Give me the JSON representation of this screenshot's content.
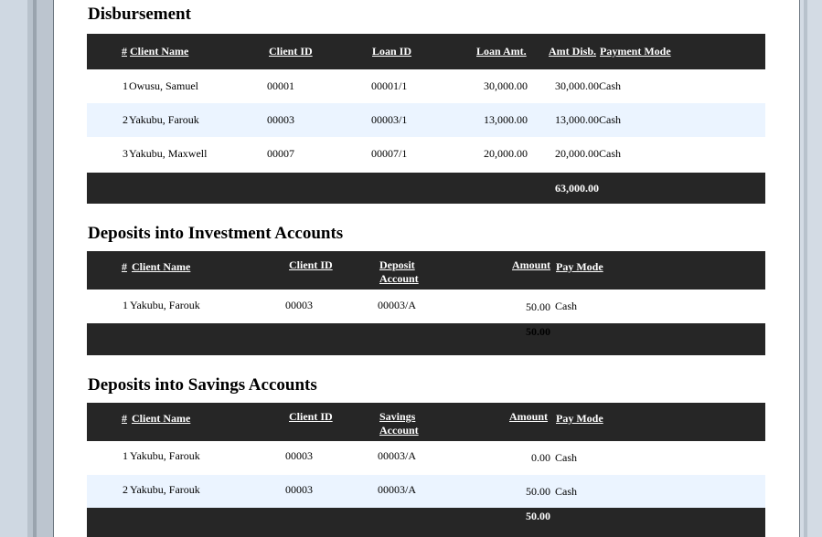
{
  "disbursement": {
    "title": "Disbursement",
    "headers": {
      "num": "#",
      "client_name": "Client Name",
      "client_id": "Client ID",
      "loan_id": "Loan ID",
      "loan_amt": "Loan Amt.",
      "amt_disb": "Amt Disb.",
      "payment_mode": "Payment Mode"
    },
    "rows": [
      {
        "num": "1",
        "client_name": "Owusu, Samuel",
        "client_id": "00001",
        "loan_id": "00001/1",
        "loan_amt": "30,000.00",
        "amt_disb": "30,000.00",
        "payment_mode": "Cash"
      },
      {
        "num": "2",
        "client_name": "Yakubu, Farouk",
        "client_id": "00003",
        "loan_id": "00003/1",
        "loan_amt": "13,000.00",
        "amt_disb": "13,000.00",
        "payment_mode": "Cash"
      },
      {
        "num": "3",
        "client_name": "Yakubu, Maxwell",
        "client_id": "00007",
        "loan_id": "00007/1",
        "loan_amt": "20,000.00",
        "amt_disb": "20,000.00",
        "payment_mode": "Cash"
      }
    ],
    "total": "63,000.00"
  },
  "investment_deposits": {
    "title": "Deposits into Investment Accounts",
    "headers": {
      "num": "#",
      "client_name": "Client Name",
      "client_id": "Client ID",
      "account_line1": "Deposit",
      "account_line2": "Account",
      "amount": "Amount",
      "pay_mode": "Pay Mode"
    },
    "rows": [
      {
        "num": "1",
        "client_name": "Yakubu, Farouk",
        "client_id": "00003",
        "account": "00003/A",
        "amount": "50.00",
        "pay_mode": "Cash"
      }
    ],
    "total": "50.00"
  },
  "savings_deposits": {
    "title": "Deposits into Savings Accounts",
    "headers": {
      "num": "#",
      "client_name": "Client Name",
      "client_id": "Client ID",
      "account_line1": "Savings",
      "account_line2": "Account",
      "amount": "Amount",
      "pay_mode": "Pay Mode"
    },
    "rows": [
      {
        "num": "1",
        "client_name": "Yakubu, Farouk",
        "client_id": "00003",
        "account": "00003/A",
        "amount": "0.00",
        "pay_mode": "Cash"
      },
      {
        "num": "2",
        "client_name": "Yakubu, Farouk",
        "client_id": "00003",
        "account": "00003/A",
        "amount": "50.00",
        "pay_mode": "Cash"
      }
    ],
    "total": "50.00"
  }
}
